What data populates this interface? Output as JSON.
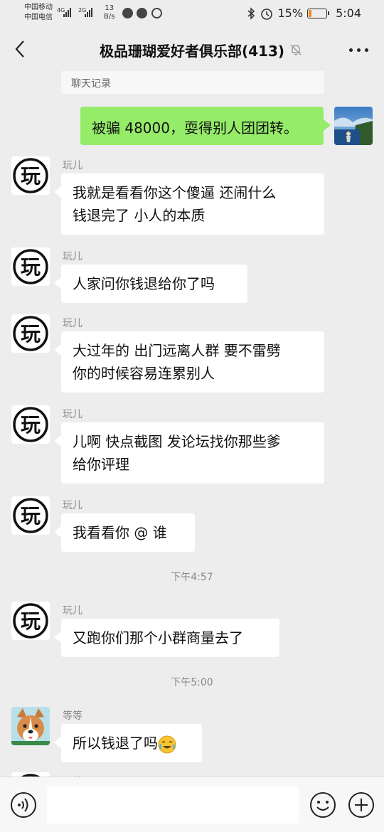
{
  "status_bar": {
    "carrier_1": "中国移动",
    "carrier_2": "中国电信",
    "sig1_label": "4G",
    "sig2_label": "2G",
    "speed_value": "13",
    "speed_unit": "B/s",
    "battery_text": "15%",
    "battery_level": 0.15,
    "time": "5:04"
  },
  "header": {
    "title": "极品珊瑚爱好者俱乐部(413)"
  },
  "chat": {
    "quote_label": "聊天记录",
    "outgoing": {
      "text": "被骗 48000，耍得别人团团转。"
    },
    "messages": [
      {
        "sender": "玩儿",
        "line1": "我就是看看你这个傻逼 还闹什么",
        "line2": "钱退完了  小人的本质"
      },
      {
        "sender": "玩儿",
        "line1": "人家问你钱退给你了吗"
      },
      {
        "sender": "玩儿",
        "line1": "大过年的 出门远离人群  要不雷劈",
        "line2": "你的时候容易连累别人"
      },
      {
        "sender": "玩儿",
        "line1": "儿啊 快点截图  发论坛找你那些爹",
        "line2": "给你评理"
      },
      {
        "sender": "玩儿",
        "line1": "我看看你  @  谁"
      },
      {
        "sender": "玩儿",
        "line1": "又跑你们那个小群商量去了"
      },
      {
        "sender": "等等",
        "line1": "所以钱退了吗"
      }
    ],
    "time_1": "下午4:57",
    "time_2": "下午5:00",
    "partial_sender": "玩儿"
  },
  "avatar_glyph": "玩",
  "colors": {
    "background": "#ededed",
    "outgoing_bubble": "#95ec69",
    "incoming_bubble": "#ffffff",
    "battery_fill": "#f08a1c"
  },
  "icons": {
    "back": "chevron-left-icon",
    "mute": "bell-off-icon",
    "more": "more-dots-icon",
    "voice": "voice-icon",
    "emoji": "smiley-icon",
    "plus": "plus-circle-icon"
  }
}
